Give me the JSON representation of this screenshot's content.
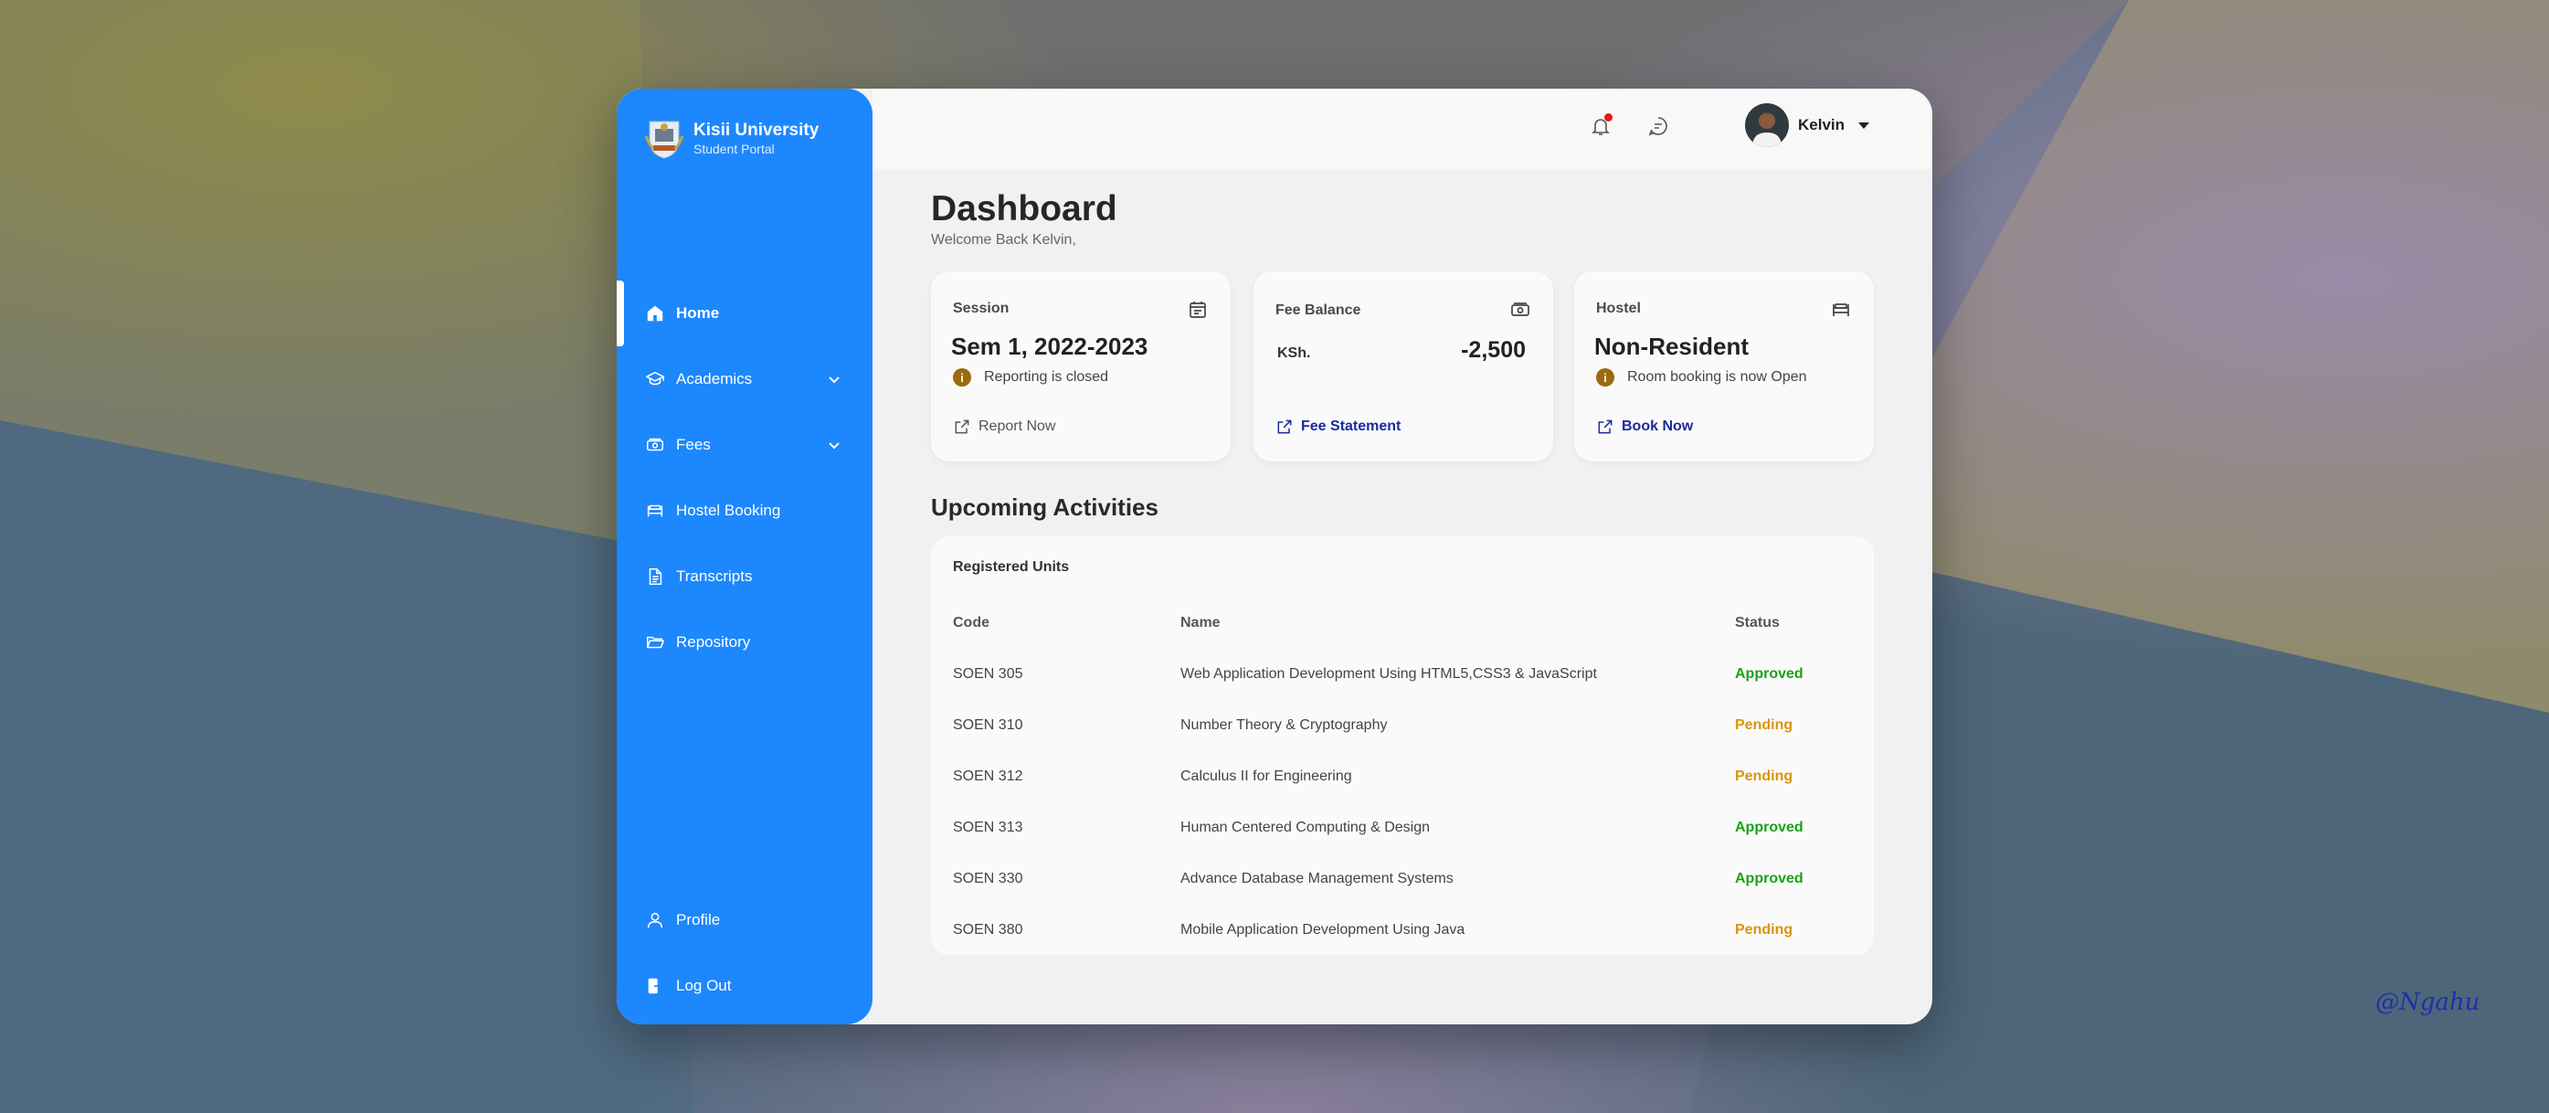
{
  "brand": {
    "name": "Kisii University",
    "subtitle": "Student Portal"
  },
  "sidebar": {
    "items": [
      {
        "label": "Home",
        "icon": "home-icon",
        "active": true
      },
      {
        "label": "Academics",
        "icon": "graduation-cap-icon",
        "expandable": true
      },
      {
        "label": "Fees",
        "icon": "money-icon",
        "expandable": true
      },
      {
        "label": "Hostel Booking",
        "icon": "bed-icon"
      },
      {
        "label": "Transcripts",
        "icon": "document-icon"
      },
      {
        "label": "Repository",
        "icon": "folder-icon"
      }
    ],
    "bottom_items": [
      {
        "label": "Profile",
        "icon": "user-icon"
      },
      {
        "label": "Log Out",
        "icon": "logout-icon"
      }
    ]
  },
  "header": {
    "user_name": "Kelvin",
    "has_notification": true
  },
  "dashboard": {
    "title": "Dashboard",
    "welcome": "Welcome Back Kelvin,"
  },
  "cards": {
    "session": {
      "label": "Session",
      "value": "Sem 1, 2022-2023",
      "note": "Reporting is closed",
      "link": "Report Now"
    },
    "fee": {
      "label": "Fee Balance",
      "currency": "KSh.",
      "amount": "-2,500",
      "link": "Fee Statement"
    },
    "hostel": {
      "label": "Hostel",
      "value": "Non-Resident",
      "note": "Room booking is now Open",
      "link": "Book Now"
    }
  },
  "activities": {
    "title": "Upcoming Activities",
    "table_title": "Registered Units",
    "columns": [
      "Code",
      "Name",
      "Status"
    ],
    "rows": [
      {
        "code": "SOEN 305",
        "name": "Web Application Development Using HTML5,CSS3 & JavaScript",
        "status": "Approved"
      },
      {
        "code": "SOEN 310",
        "name": "Number Theory & Cryptography",
        "status": "Pending"
      },
      {
        "code": "SOEN 312",
        "name": "Calculus II for Engineering",
        "status": "Pending"
      },
      {
        "code": "SOEN 313",
        "name": "Human Centered Computing & Design",
        "status": "Approved"
      },
      {
        "code": "SOEN 330",
        "name": "Advance Database Management Systems",
        "status": "Approved"
      },
      {
        "code": "SOEN 380",
        "name": "Mobile Application Development Using Java",
        "status": "Pending"
      }
    ]
  },
  "colors": {
    "accent": "#1d87fd",
    "approved": "#1aa11a",
    "pending": "#d9950c",
    "link": "#1b2a9e",
    "muted_link": "#555555"
  },
  "watermark": "@Ngahu"
}
